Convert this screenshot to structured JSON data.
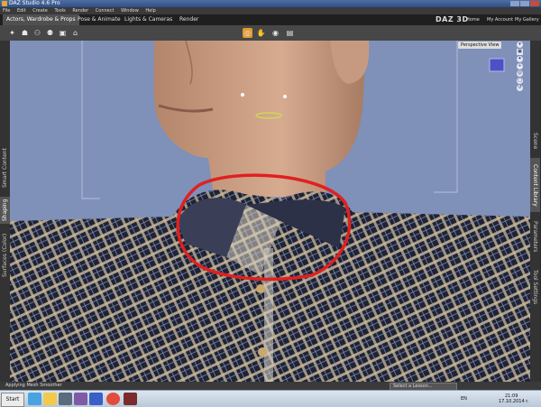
{
  "window": {
    "title": "DAZ Studio 4.6 Pro"
  },
  "menu": [
    "File",
    "Edit",
    "Create",
    "Tools",
    "Render",
    "Connect",
    "Window",
    "Help"
  ],
  "tabs": [
    {
      "label": "Actors, Wardrobe & Props",
      "active": true
    },
    {
      "label": "Pose & Animate",
      "active": false
    },
    {
      "label": "Lights & Cameras",
      "active": false
    },
    {
      "label": "Render",
      "active": false
    }
  ],
  "brand": "DAZ 3D",
  "header_links": {
    "home": "Home",
    "store": "My Account",
    "gallery": "My Gallery"
  },
  "toolbar_icons": [
    "figure-pose-icon",
    "figure-add-icon",
    "figure-group-icon",
    "figure-people-icon",
    "image-icon",
    "home-icon",
    "spot-render-icon",
    "hand-icon",
    "camera-icon",
    "box-icon"
  ],
  "left_tabs": [
    "Smart Content",
    "Shaping",
    "Surfaces (Color)"
  ],
  "right_tabs": [
    "Scene",
    "Content Library",
    "Parameters",
    "Tool Settings"
  ],
  "viewport": {
    "camera": "Perspective View",
    "bg_color": "#7f90b9"
  },
  "status": {
    "message": "Applying Mesh Smoother",
    "lesson": "Select a Lesson..."
  },
  "taskbar": {
    "start": "Start",
    "lang": "EN",
    "time": "21:09",
    "date": "17.10.2014 r."
  },
  "colors": {
    "accent": "#e39b31",
    "annotation": "#e02020"
  }
}
